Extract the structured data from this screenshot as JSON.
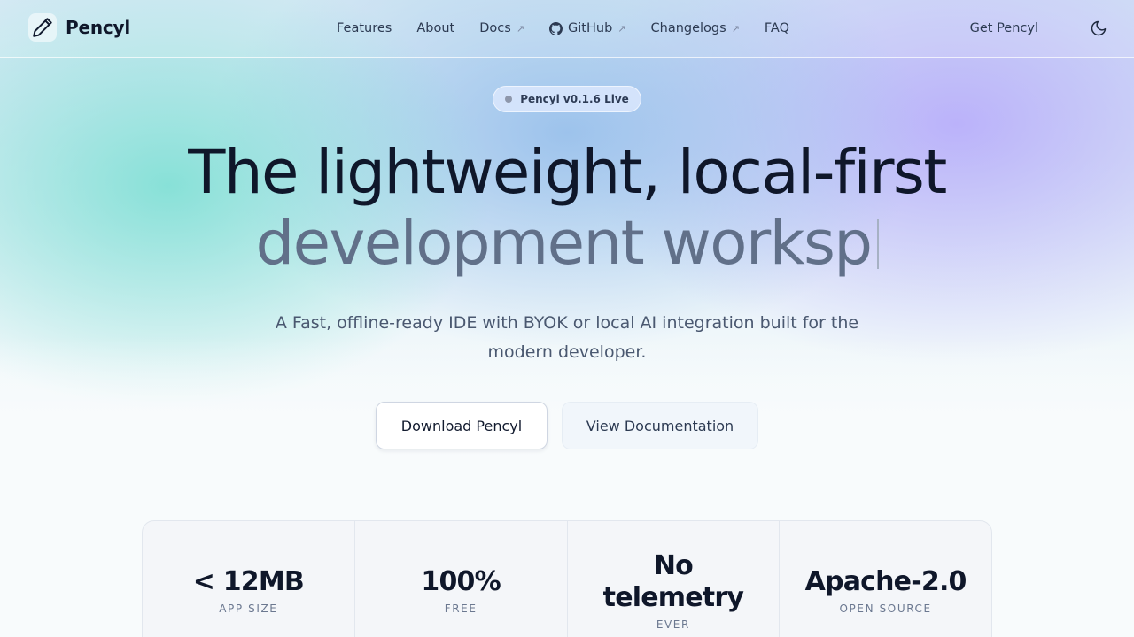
{
  "brand": {
    "name": "Pencyl",
    "logo_icon": "pencil-icon"
  },
  "nav": {
    "links": [
      {
        "label": "Features",
        "external": false
      },
      {
        "label": "About",
        "external": false
      },
      {
        "label": "Docs",
        "external": true
      },
      {
        "label": "GitHub",
        "external": true,
        "icon": "github-icon"
      },
      {
        "label": "Changelogs",
        "external": true
      },
      {
        "label": "FAQ",
        "external": false
      }
    ],
    "external_glyph": "↗",
    "get_label": "Get Pencyl",
    "theme_icon": "moon-icon"
  },
  "hero": {
    "badge": "Pencyl v0.1.6 Live",
    "title_line1": "The lightweight, local-first",
    "title_line2": "development worksp",
    "subtitle": "A Fast, offline-ready IDE with BYOK or local AI integration built for the modern developer.",
    "primary_button": "Download Pencyl",
    "secondary_button": "View Documentation"
  },
  "stats": [
    {
      "value": "< 12MB",
      "label": "App size"
    },
    {
      "value": "100%",
      "label": "Free"
    },
    {
      "value": "No telemetry",
      "label": "Ever"
    },
    {
      "value": "Apache-2.0",
      "label": "Open source"
    }
  ],
  "colors": {
    "text_primary": "#0f172a",
    "text_muted": "#617089",
    "accent_teal": "#78ded2",
    "accent_violet": "#b9affa"
  }
}
